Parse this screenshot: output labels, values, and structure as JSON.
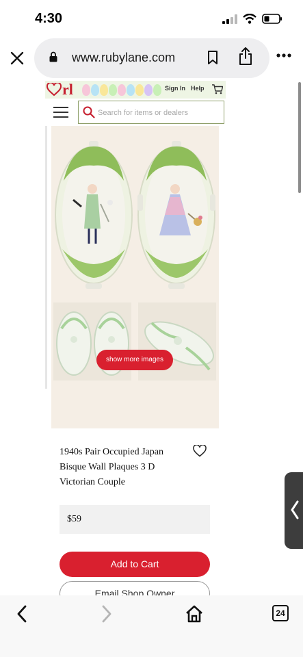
{
  "status_bar": {
    "time": "4:30"
  },
  "browser": {
    "url": "www.rubylane.com",
    "tab_count": "24"
  },
  "site": {
    "logo_text": "rl",
    "signin": "Sign In",
    "help": "Help",
    "search_placeholder": "Search for items or dealers",
    "show_more": "show more images",
    "egg_colors": [
      "#f7c6d9",
      "#b7e3f5",
      "#f9e79a",
      "#c8f0b6",
      "#f7c6d9",
      "#b7e3f5",
      "#f9e79a",
      "#d7c4f5",
      "#c8f0b6"
    ]
  },
  "product": {
    "title_lines": [
      "1940s Pair Occupied Japan",
      "Bisque Wall Plaques 3 D",
      "Victorian Couple"
    ],
    "price": "$59",
    "add_to_cart": "Add to Cart",
    "email_owner": "Email Shop Owner"
  },
  "colors": {
    "brand_red": "#d9202f",
    "plaque_green": "#9cc76a"
  },
  "icons": [
    "close-icon",
    "lock-icon",
    "bookmark-icon",
    "share-icon",
    "more-icon",
    "heart-icon",
    "cart-icon",
    "search-icon",
    "menu-icon",
    "back-icon",
    "forward-icon",
    "home-icon",
    "tabs-icon",
    "chevron-left-icon"
  ]
}
